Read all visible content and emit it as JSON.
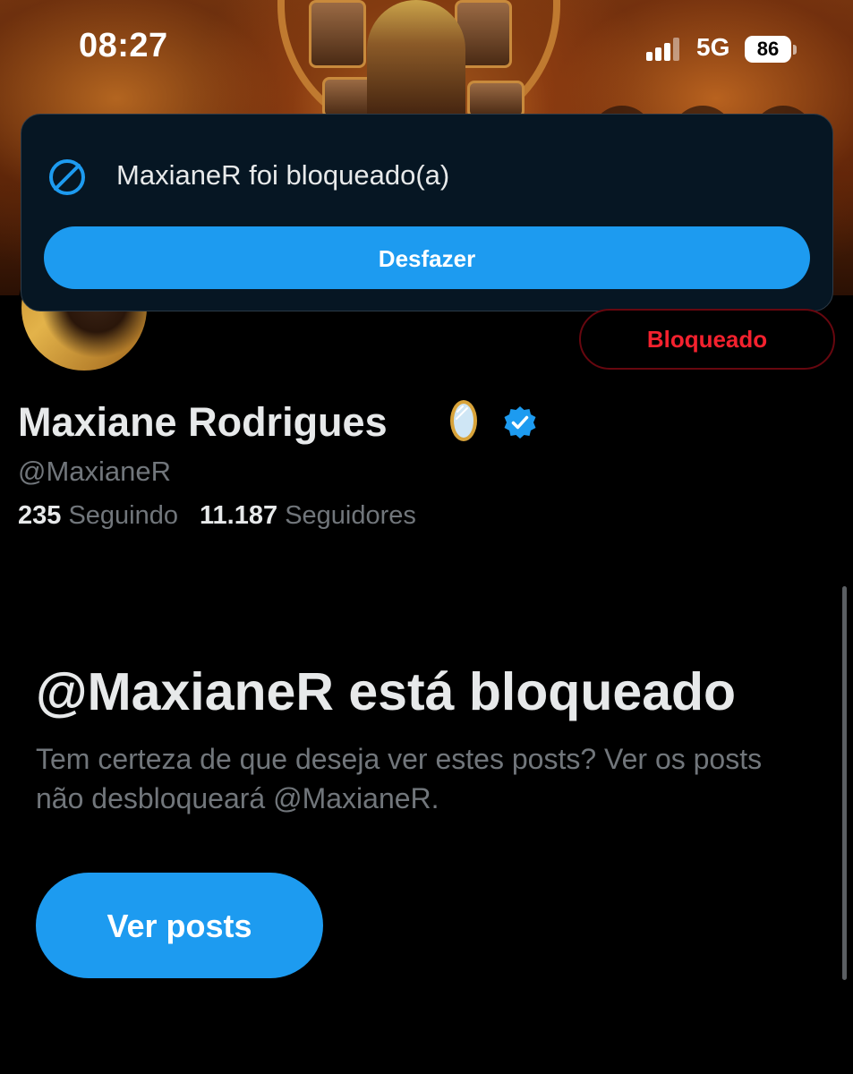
{
  "status_bar": {
    "time": "08:27",
    "network": "5G",
    "battery": "86"
  },
  "toast": {
    "message": "MaxianeR foi bloqueado(a)",
    "undo_label": "Desfazer",
    "icon": "block-icon"
  },
  "profile": {
    "display_name": "Maxiane Rodrigues",
    "name_emoji": "mirror-icon",
    "verified": true,
    "handle": "@MaxianeR",
    "following_count": "235",
    "following_label": "Seguindo",
    "followers_count": "11.187",
    "followers_label": "Seguidores",
    "blocked_button_label": "Bloqueado"
  },
  "blocked_notice": {
    "title": "@MaxianeR está bloqueado",
    "description": "Tem certeza de que deseja ver estes posts? Ver os posts não desbloqueará @MaxianeR.",
    "view_posts_label": "Ver posts"
  },
  "colors": {
    "accent": "#1d9bf0",
    "danger": "#f4212e",
    "muted_text": "#71767b",
    "toast_bg": "#061623"
  }
}
